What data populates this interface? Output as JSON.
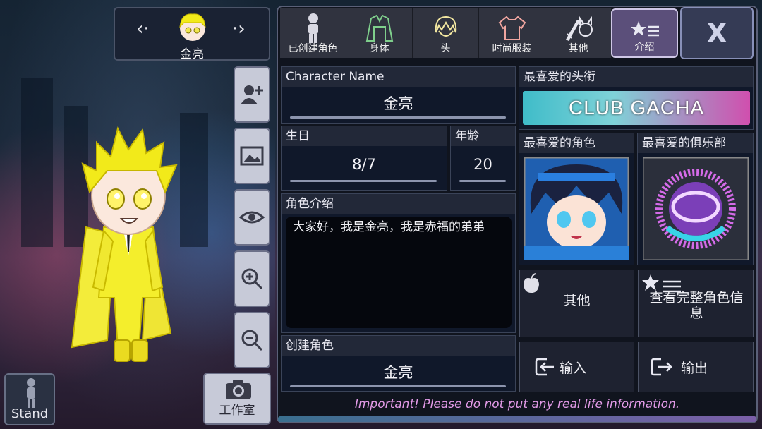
{
  "selector": {
    "character_name": "金亮"
  },
  "left_buttons": {
    "stand_label": "Stand",
    "studio_label": "工作室"
  },
  "tabs": [
    {
      "label": "已创建角色",
      "icon": "mannequin-icon"
    },
    {
      "label": "身体",
      "icon": "jacket-icon"
    },
    {
      "label": "头",
      "icon": "hair-icon"
    },
    {
      "label": "时尚服装",
      "icon": "shirt-icon"
    },
    {
      "label": "其他",
      "icon": "sword-cat-icon"
    },
    {
      "label": "介绍",
      "icon": "star-list-icon"
    }
  ],
  "close_label": "X",
  "profile": {
    "name_header": "Character Name",
    "name_value": "金亮",
    "birthday_header": "生日",
    "birthday_value": "8/7",
    "age_header": "年龄",
    "age_value": "20",
    "intro_header": "角色介绍",
    "intro_value": "大家好，我是金亮，我是赤福的弟弟",
    "creator_header": "创建角色",
    "creator_value": "金亮"
  },
  "favorites": {
    "headwear_header": "最喜爱的头衔",
    "headwear_banner": "CLUB GACHA",
    "character_header": "最喜爱的角色",
    "club_header": "最喜爱的俱乐部"
  },
  "actions": {
    "other_label": "其他",
    "full_info_label": "查看完整角色信息",
    "import_label": "输入",
    "export_label": "输出"
  },
  "footer_note": "Important! Please do not put any real life information.",
  "colors": {
    "active_tab": "#5b4f7a",
    "note_text": "#e39be8",
    "character_yellow": "#f2ea1a"
  }
}
